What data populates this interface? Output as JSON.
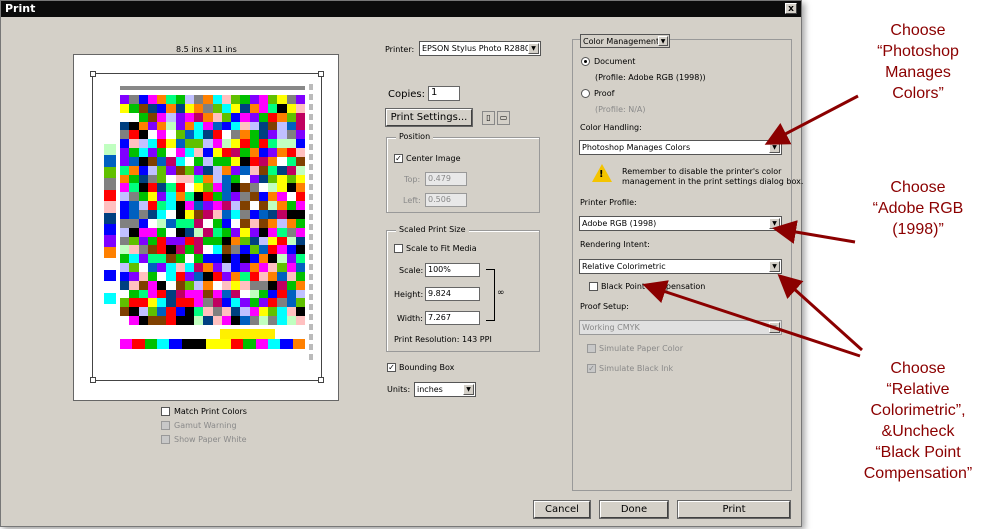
{
  "window": {
    "title": "Print",
    "close_label": "x"
  },
  "preview": {
    "page_size_label": "8.5 ins x 11 ins"
  },
  "printer": {
    "label": "Printer:",
    "value": "EPSON Stylus Photo R2880"
  },
  "copies": {
    "label": "Copies:",
    "value": "1"
  },
  "print_settings_button": "Print Settings...",
  "position": {
    "title": "Position",
    "center_image_label": "Center Image",
    "center_image_checked": true,
    "top_label": "Top:",
    "top_value": "0.479",
    "left_label": "Left:",
    "left_value": "0.506"
  },
  "scaled": {
    "title": "Scaled Print Size",
    "scale_to_fit_label": "Scale to Fit Media",
    "scale_label": "Scale:",
    "scale_value": "100%",
    "height_label": "Height:",
    "height_value": "9.824",
    "width_label": "Width:",
    "width_value": "7.267",
    "resolution": "Print Resolution: 143 PPI"
  },
  "bounding_box_label": "Bounding Box",
  "units": {
    "label": "Units:",
    "value": "inches"
  },
  "preview_options": {
    "match_print_colors": "Match Print Colors",
    "gamut_warning": "Gamut Warning",
    "show_paper_white": "Show Paper White"
  },
  "color_mgmt": {
    "menu_value": "Color Management",
    "document_label": "Document",
    "document_profile": "(Profile: Adobe RGB (1998))",
    "proof_label": "Proof",
    "proof_profile": "(Profile: N/A)",
    "color_handling_label": "Color Handling:",
    "color_handling_value": "Photoshop Manages Colors",
    "warning_line1": "Remember to disable the printer's color",
    "warning_line2": "management in the print settings dialog box.",
    "printer_profile_label": "Printer Profile:",
    "printer_profile_value": "Adobe RGB (1998)",
    "rendering_intent_label": "Rendering Intent:",
    "rendering_intent_value": "Relative Colorimetric",
    "bpc_label": "Black Point Compensation",
    "proof_setup_label": "Proof Setup:",
    "proof_setup_value": "Working CMYK",
    "simulate_paper_label": "Simulate Paper Color",
    "simulate_ink_label": "Simulate Black Ink"
  },
  "buttons": {
    "cancel": "Cancel",
    "done": "Done",
    "print": "Print"
  },
  "annotations": {
    "a1": [
      "Choose",
      "“Photoshop",
      "Manages",
      "Colors”"
    ],
    "a2": [
      "Choose",
      "“Adobe RGB",
      "(1998)”"
    ],
    "a3": [
      "Choose",
      "“Relative",
      "Colorimetric”,",
      "&Uncheck",
      "“Black Point",
      "Compensation”"
    ]
  },
  "colors": {
    "annotation": "#8b0000",
    "dialog_bg": "#d4d0c8",
    "titlebar": "#0b0b0b"
  }
}
